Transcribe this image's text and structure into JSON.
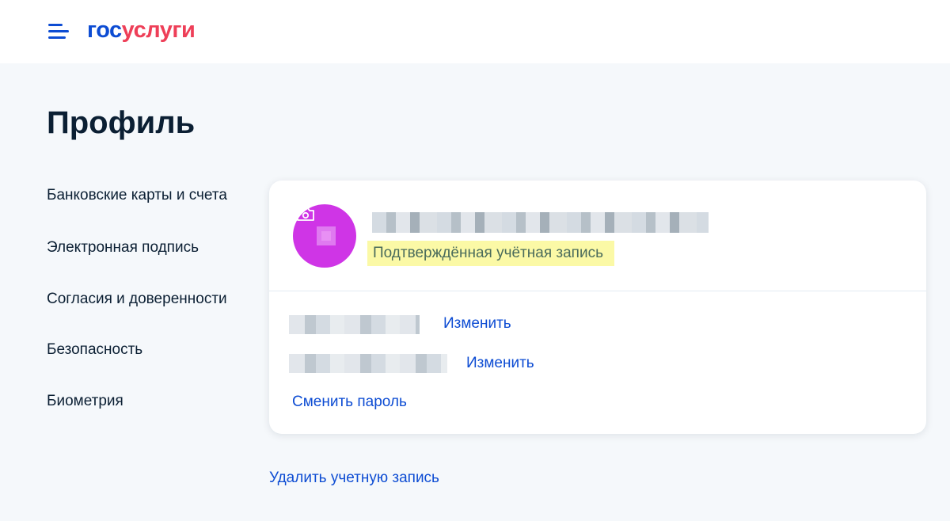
{
  "header": {
    "logo_part1": "гос",
    "logo_part2": "услуги"
  },
  "page": {
    "title": "Профиль"
  },
  "sidebar": {
    "items": [
      {
        "label": "Банковские карты и счета"
      },
      {
        "label": "Электронная подпись"
      },
      {
        "label": "Согласия и доверенности"
      },
      {
        "label": "Безопасность"
      },
      {
        "label": "Биометрия"
      }
    ]
  },
  "profile_card": {
    "status": "Подтверждённая учётная запись",
    "change_label_1": "Изменить",
    "change_label_2": "Изменить",
    "change_password": "Сменить пароль"
  },
  "delete_account": "Удалить учетную запись",
  "colors": {
    "brand_blue": "#0d4cd3",
    "brand_red": "#ee3f58",
    "avatar": "#cf35e6",
    "status_highlight": "#fbf9a6"
  },
  "icons": [
    "menu-icon",
    "camera-icon"
  ]
}
